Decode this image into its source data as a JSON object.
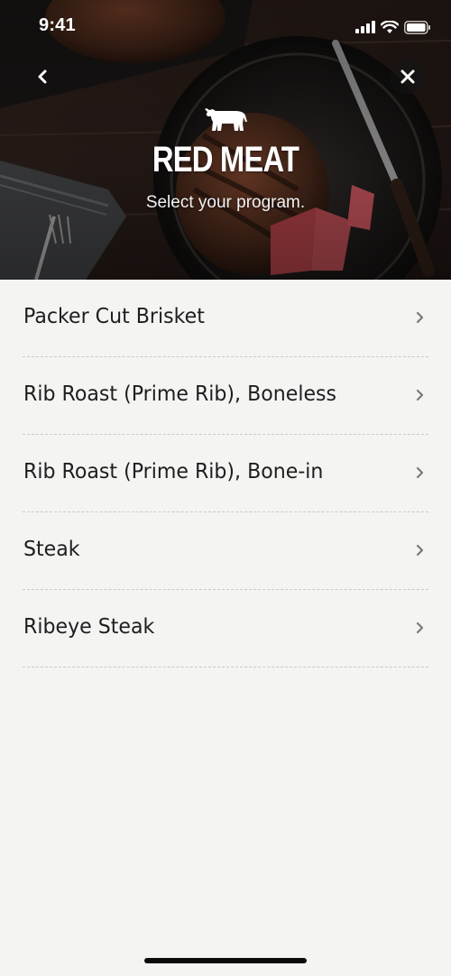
{
  "status_bar": {
    "time": "9:41"
  },
  "header": {
    "title": "RED MEAT",
    "subtitle": "Select your program.",
    "back_icon": "chevron-left-icon",
    "close_icon": "close-icon",
    "category_icon": "cow-icon"
  },
  "programs": [
    {
      "label": "Packer Cut Brisket"
    },
    {
      "label": "Rib Roast (Prime Rib), Boneless"
    },
    {
      "label": "Rib Roast (Prime Rib), Bone-in"
    },
    {
      "label": "Steak"
    },
    {
      "label": "Ribeye Steak"
    }
  ],
  "colors": {
    "background": "#f4f4f3",
    "text": "#1e1e1e",
    "divider": "#c9c9c9",
    "chevron": "#7a7a7a"
  }
}
